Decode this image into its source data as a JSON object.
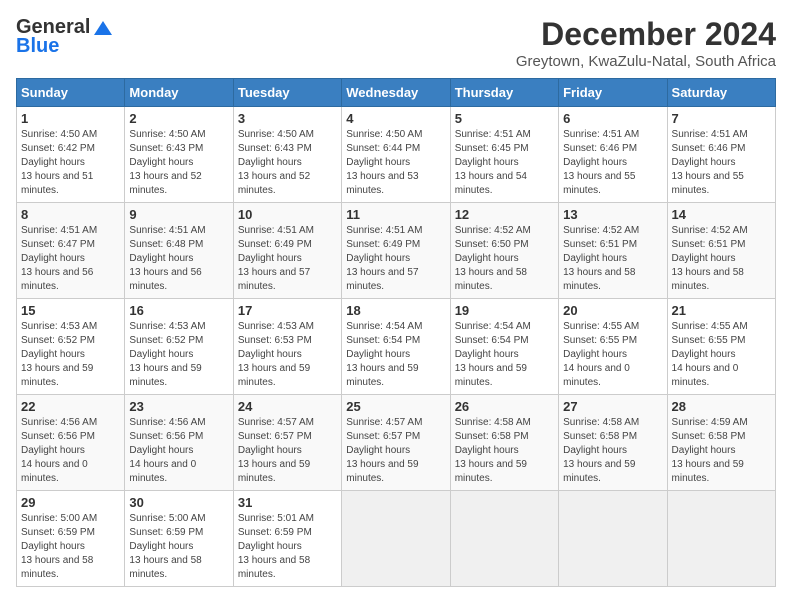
{
  "logo": {
    "line1": "General",
    "line2": "Blue"
  },
  "title": "December 2024",
  "subtitle": "Greytown, KwaZulu-Natal, South Africa",
  "weekdays": [
    "Sunday",
    "Monday",
    "Tuesday",
    "Wednesday",
    "Thursday",
    "Friday",
    "Saturday"
  ],
  "weeks": [
    [
      {
        "day": "1",
        "sunrise": "4:50 AM",
        "sunset": "6:42 PM",
        "daylight": "13 hours and 51 minutes."
      },
      {
        "day": "2",
        "sunrise": "4:50 AM",
        "sunset": "6:43 PM",
        "daylight": "13 hours and 52 minutes."
      },
      {
        "day": "3",
        "sunrise": "4:50 AM",
        "sunset": "6:43 PM",
        "daylight": "13 hours and 52 minutes."
      },
      {
        "day": "4",
        "sunrise": "4:50 AM",
        "sunset": "6:44 PM",
        "daylight": "13 hours and 53 minutes."
      },
      {
        "day": "5",
        "sunrise": "4:51 AM",
        "sunset": "6:45 PM",
        "daylight": "13 hours and 54 minutes."
      },
      {
        "day": "6",
        "sunrise": "4:51 AM",
        "sunset": "6:46 PM",
        "daylight": "13 hours and 55 minutes."
      },
      {
        "day": "7",
        "sunrise": "4:51 AM",
        "sunset": "6:46 PM",
        "daylight": "13 hours and 55 minutes."
      }
    ],
    [
      {
        "day": "8",
        "sunrise": "4:51 AM",
        "sunset": "6:47 PM",
        "daylight": "13 hours and 56 minutes."
      },
      {
        "day": "9",
        "sunrise": "4:51 AM",
        "sunset": "6:48 PM",
        "daylight": "13 hours and 56 minutes."
      },
      {
        "day": "10",
        "sunrise": "4:51 AM",
        "sunset": "6:49 PM",
        "daylight": "13 hours and 57 minutes."
      },
      {
        "day": "11",
        "sunrise": "4:51 AM",
        "sunset": "6:49 PM",
        "daylight": "13 hours and 57 minutes."
      },
      {
        "day": "12",
        "sunrise": "4:52 AM",
        "sunset": "6:50 PM",
        "daylight": "13 hours and 58 minutes."
      },
      {
        "day": "13",
        "sunrise": "4:52 AM",
        "sunset": "6:51 PM",
        "daylight": "13 hours and 58 minutes."
      },
      {
        "day": "14",
        "sunrise": "4:52 AM",
        "sunset": "6:51 PM",
        "daylight": "13 hours and 58 minutes."
      }
    ],
    [
      {
        "day": "15",
        "sunrise": "4:53 AM",
        "sunset": "6:52 PM",
        "daylight": "13 hours and 59 minutes."
      },
      {
        "day": "16",
        "sunrise": "4:53 AM",
        "sunset": "6:52 PM",
        "daylight": "13 hours and 59 minutes."
      },
      {
        "day": "17",
        "sunrise": "4:53 AM",
        "sunset": "6:53 PM",
        "daylight": "13 hours and 59 minutes."
      },
      {
        "day": "18",
        "sunrise": "4:54 AM",
        "sunset": "6:54 PM",
        "daylight": "13 hours and 59 minutes."
      },
      {
        "day": "19",
        "sunrise": "4:54 AM",
        "sunset": "6:54 PM",
        "daylight": "13 hours and 59 minutes."
      },
      {
        "day": "20",
        "sunrise": "4:55 AM",
        "sunset": "6:55 PM",
        "daylight": "14 hours and 0 minutes."
      },
      {
        "day": "21",
        "sunrise": "4:55 AM",
        "sunset": "6:55 PM",
        "daylight": "14 hours and 0 minutes."
      }
    ],
    [
      {
        "day": "22",
        "sunrise": "4:56 AM",
        "sunset": "6:56 PM",
        "daylight": "14 hours and 0 minutes."
      },
      {
        "day": "23",
        "sunrise": "4:56 AM",
        "sunset": "6:56 PM",
        "daylight": "14 hours and 0 minutes."
      },
      {
        "day": "24",
        "sunrise": "4:57 AM",
        "sunset": "6:57 PM",
        "daylight": "13 hours and 59 minutes."
      },
      {
        "day": "25",
        "sunrise": "4:57 AM",
        "sunset": "6:57 PM",
        "daylight": "13 hours and 59 minutes."
      },
      {
        "day": "26",
        "sunrise": "4:58 AM",
        "sunset": "6:58 PM",
        "daylight": "13 hours and 59 minutes."
      },
      {
        "day": "27",
        "sunrise": "4:58 AM",
        "sunset": "6:58 PM",
        "daylight": "13 hours and 59 minutes."
      },
      {
        "day": "28",
        "sunrise": "4:59 AM",
        "sunset": "6:58 PM",
        "daylight": "13 hours and 59 minutes."
      }
    ],
    [
      {
        "day": "29",
        "sunrise": "5:00 AM",
        "sunset": "6:59 PM",
        "daylight": "13 hours and 58 minutes."
      },
      {
        "day": "30",
        "sunrise": "5:00 AM",
        "sunset": "6:59 PM",
        "daylight": "13 hours and 58 minutes."
      },
      {
        "day": "31",
        "sunrise": "5:01 AM",
        "sunset": "6:59 PM",
        "daylight": "13 hours and 58 minutes."
      },
      null,
      null,
      null,
      null
    ]
  ]
}
